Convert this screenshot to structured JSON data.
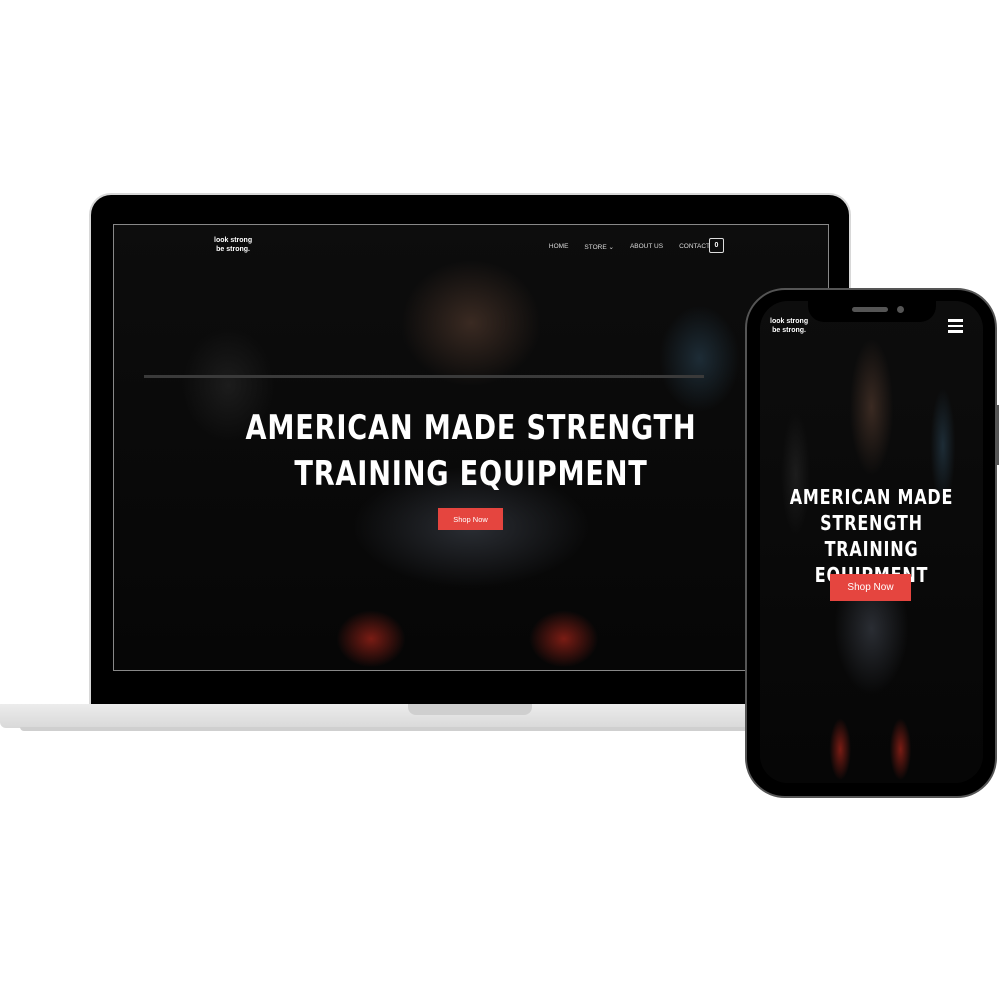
{
  "brand": {
    "line1": "look strong",
    "line2": "be strong."
  },
  "nav": {
    "items": [
      "HOME",
      "STORE",
      "ABOUT US",
      "CONTACT"
    ],
    "cart_count": "0"
  },
  "hero": {
    "line1": "AMERICAN MADE STRENGTH",
    "line2": "TRAINING EQUIPMENT",
    "cta": "Shop Now"
  },
  "mobile_hero": {
    "line1": "AMERICAN MADE",
    "line2": "STRENGTH TRAINING",
    "line3": "EQUIPMENT",
    "cta": "Shop Now"
  },
  "colors": {
    "accent": "#e5453f",
    "background": "#050505"
  }
}
